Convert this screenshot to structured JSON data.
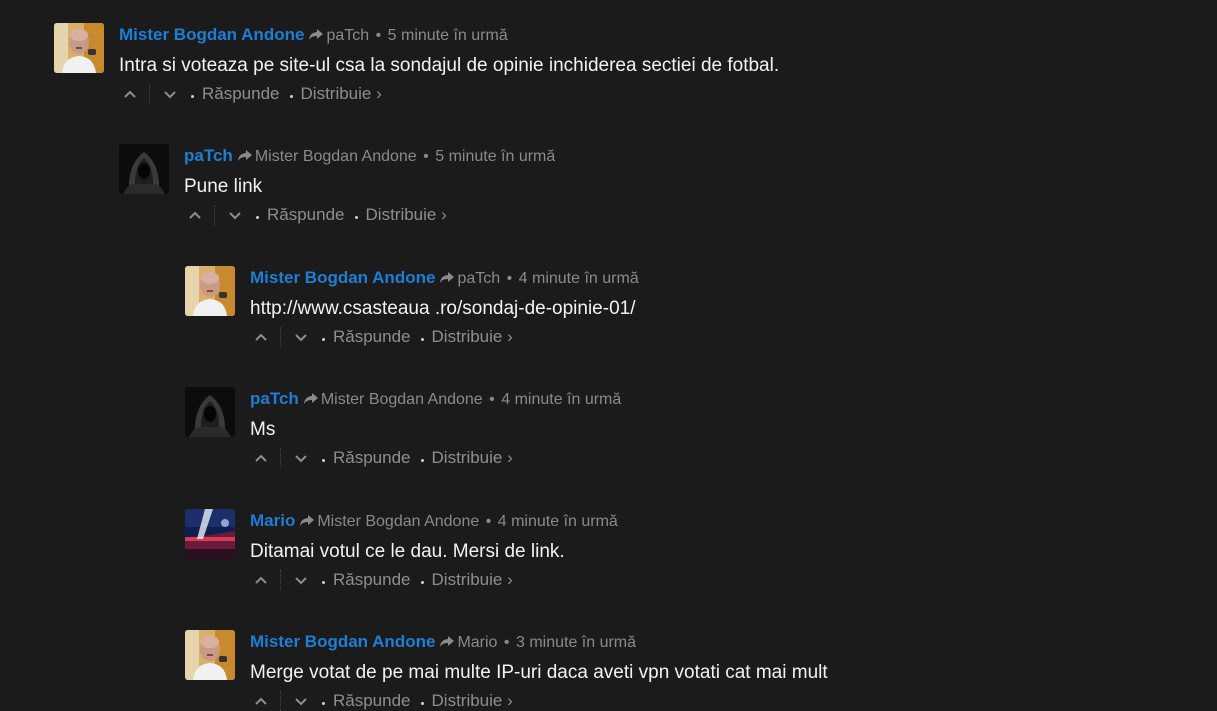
{
  "actions": {
    "reply_label": "Răspunde",
    "share_label": "Distribuie ›"
  },
  "colors": {
    "background": "#1b1b1b",
    "author": "#1d7ed6",
    "meta": "#8a8a8a",
    "message": "#f2f2f2"
  },
  "icons": {
    "reply": "share-arrow-icon",
    "upvote": "chevron-up-icon",
    "downvote": "chevron-down-icon"
  },
  "comments": [
    {
      "author": "Mister Bogdan Andone",
      "parent": "paTch",
      "time": "5 minute în urmă",
      "message": "Intra si voteaza pe site-ul csa la sondajul de opinie inchiderea sectiei de fotbal.",
      "avatar": "bald-man-avatar"
    },
    {
      "author": "paTch",
      "parent": "Mister Bogdan Andone",
      "time": "5 minute în urmă",
      "message": "Pune link",
      "avatar": "hooded-figure-avatar"
    },
    {
      "author": "Mister Bogdan Andone",
      "parent": "paTch",
      "time": "4 minute în urmă",
      "message": "http://www.csasteaua .ro/sondaj-de-opinie-01/",
      "avatar": "bald-man-avatar"
    },
    {
      "author": "paTch",
      "parent": "Mister Bogdan Andone",
      "time": "4 minute în urmă",
      "message": "Ms",
      "avatar": "hooded-figure-avatar"
    },
    {
      "author": "Mario",
      "parent": "Mister Bogdan Andone",
      "time": "4 minute în urmă",
      "message": "Ditamai votul ce le dau. Mersi de link.",
      "avatar": "stadium-avatar"
    },
    {
      "author": "Mister Bogdan Andone",
      "parent": "Mario",
      "time": "3 minute în urmă",
      "message": "Merge votat de pe mai multe IP-uri daca aveti vpn votati cat mai mult",
      "avatar": "bald-man-avatar"
    }
  ]
}
